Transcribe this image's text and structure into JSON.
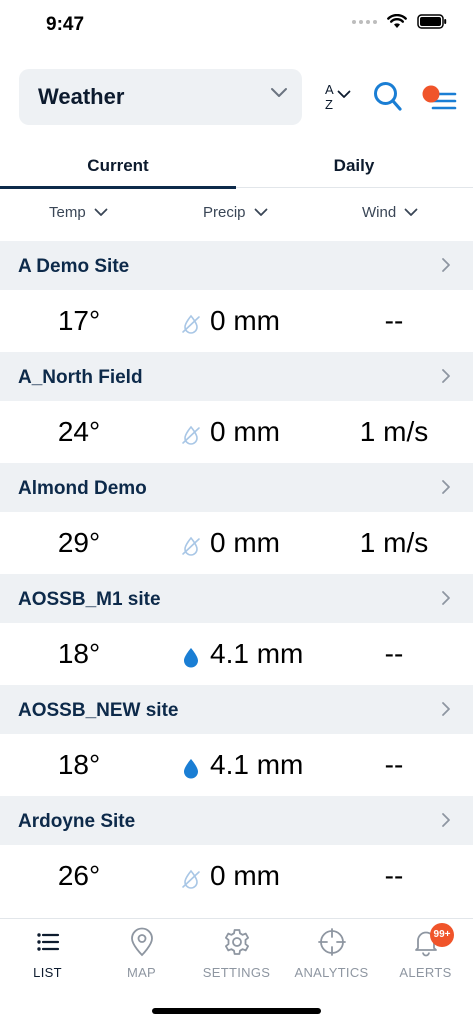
{
  "status": {
    "time": "9:47"
  },
  "header": {
    "picker_label": "Weather",
    "sort_top": "A",
    "sort_bottom": "Z"
  },
  "tabs": [
    {
      "label": "Current",
      "active": true
    },
    {
      "label": "Daily",
      "active": false
    }
  ],
  "columns": {
    "temp": "Temp",
    "precip": "Precip",
    "wind": "Wind"
  },
  "sites": [
    {
      "name": "A Demo Site",
      "temp": "17°",
      "precip": "0 mm",
      "precip_type": "none",
      "wind": "--"
    },
    {
      "name": "A_North Field",
      "temp": "24°",
      "precip": "0 mm",
      "precip_type": "none",
      "wind": "1 m/s"
    },
    {
      "name": "Almond Demo",
      "temp": "29°",
      "precip": "0 mm",
      "precip_type": "none",
      "wind": "1 m/s"
    },
    {
      "name": "AOSSB_M1 site",
      "temp": "18°",
      "precip": "4.1 mm",
      "precip_type": "rain",
      "wind": "--"
    },
    {
      "name": "AOSSB_NEW site",
      "temp": "18°",
      "precip": "4.1 mm",
      "precip_type": "rain",
      "wind": "--"
    },
    {
      "name": "Ardoyne Site",
      "temp": "26°",
      "precip": "0 mm",
      "precip_type": "none",
      "wind": "--"
    }
  ],
  "nav": [
    {
      "label": "LIST",
      "icon": "list-icon",
      "active": true
    },
    {
      "label": "MAP",
      "icon": "map-pin-icon",
      "active": false
    },
    {
      "label": "SETTINGS",
      "icon": "gear-icon",
      "active": false
    },
    {
      "label": "ANALYTICS",
      "icon": "crosshair-icon",
      "active": false
    },
    {
      "label": "ALERTS",
      "icon": "bell-icon",
      "active": false,
      "badge": "99+"
    }
  ],
  "colors": {
    "accent": "#1a7ed4",
    "brand_orange": "#f0542a",
    "navy": "#0d2a4a",
    "row_bg": "#eef1f4"
  }
}
